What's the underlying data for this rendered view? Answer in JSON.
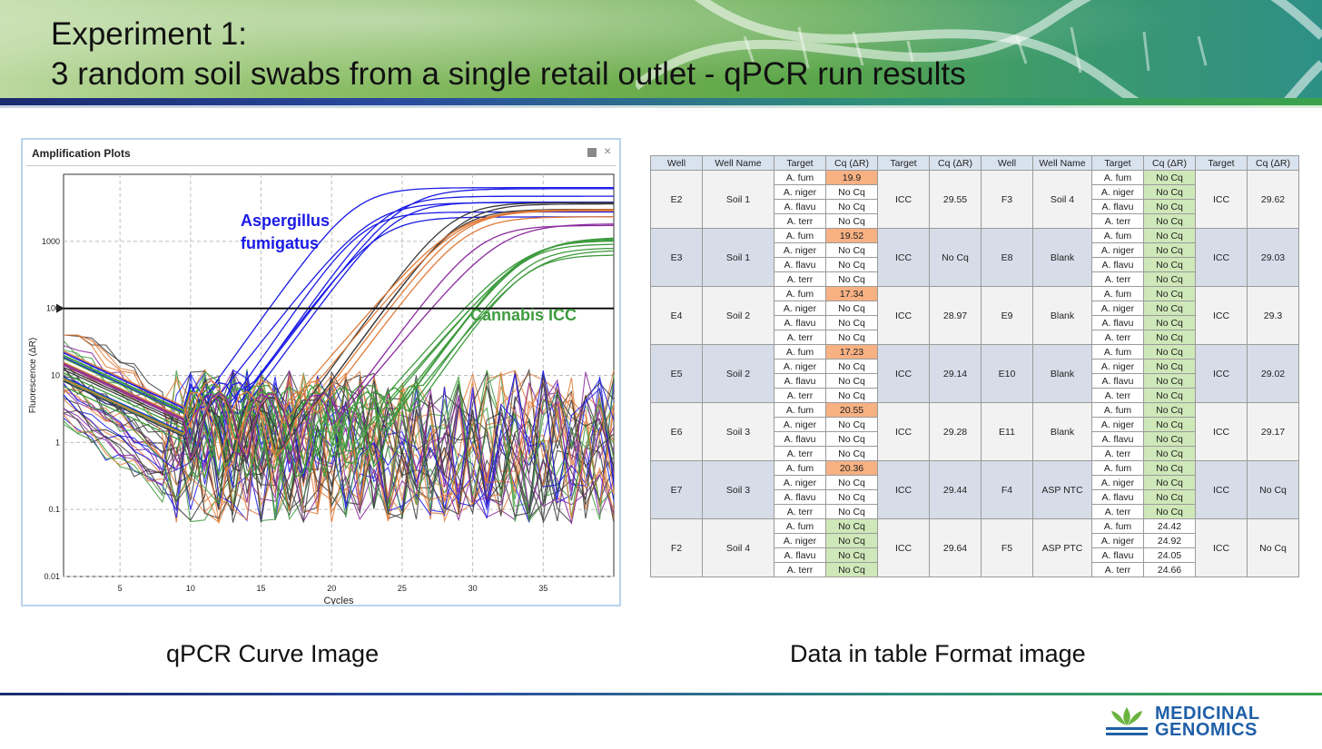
{
  "slide": {
    "title_line1": "Experiment 1:",
    "title_line2": "3 random soil swabs from a single retail outlet - qPCR run results",
    "left_caption": "qPCR Curve Image",
    "right_caption": "Data in table Format image",
    "logo_line1": "MEDICINAL",
    "logo_line2": "GENOMICS"
  },
  "plot_panel": {
    "title": "Amplification Plots",
    "close_icon": "×",
    "annotation_aspergillus_line1": "Aspergillus",
    "annotation_aspergillus_line2": "fumigatus",
    "annotation_cannabis": "Cannabis ICC",
    "colors": {
      "aspergillus": "#1a1ae6",
      "cannabis": "#3f9b3f",
      "threshold": "#000000"
    }
  },
  "chart_data": {
    "type": "line",
    "xlabel": "Cycles",
    "ylabel": "Fluorescence (ΔR)",
    "xlim": [
      1,
      40
    ],
    "ylim": [
      0.01,
      10000
    ],
    "y_scale": "log",
    "x_ticks": [
      5,
      10,
      15,
      20,
      25,
      30,
      35
    ],
    "y_ticks": [
      0.01,
      0.1,
      1,
      10,
      100,
      1000
    ],
    "y_tick_labels": [
      "0.01",
      "0.1",
      "1",
      "10",
      "100",
      "1000"
    ],
    "threshold": 100,
    "grid": true,
    "series_groups": [
      {
        "name": "Aspergillus fumigatus",
        "color": "#1a1ae6",
        "count": 7,
        "cq_range": [
          17.2,
          20.6
        ],
        "plateau": [
          2000,
          6500
        ]
      },
      {
        "name": "Cannabis ICC",
        "color": "#3f9b3f",
        "count": 9,
        "cq_range": [
          28.9,
          29.7
        ],
        "plateau": [
          500,
          1300
        ]
      },
      {
        "color": "#3b3b3b",
        "count": 3,
        "cq_range": [
          24.0,
          24.7
        ],
        "plateau": [
          2500,
          4500
        ]
      },
      {
        "color": "#e07b39",
        "count": 4,
        "cq_range": [
          24.4,
          25.0
        ],
        "plateau": [
          2300,
          3000
        ]
      },
      {
        "color": "#8a2a9e",
        "count": 2,
        "cq_range": [
          26.0,
          27.5
        ],
        "plateau": [
          1700,
          2200
        ]
      }
    ]
  },
  "table": {
    "headers": [
      "Well",
      "Well Name",
      "Target",
      "Cq (ΔR)",
      "Target",
      "Cq (ΔR)",
      "Well",
      "Well Name",
      "Target",
      "Cq (ΔR)",
      "Target",
      "Cq (ΔR)"
    ],
    "groups": [
      {
        "well": "E2",
        "well_name": "Soil 1",
        "icc_target": "ICC",
        "icc_cq": "29.55",
        "well_r": "F3",
        "well_name_r": "Soil 4",
        "icc_target_r": "ICC",
        "icc_cq_r": "29.62",
        "rows": [
          {
            "target": "A. fum",
            "cq": "19.9",
            "target_r": "A. fum",
            "cq_r": "No Cq"
          },
          {
            "target": "A. niger",
            "cq": "No Cq",
            "target_r": "A. niger",
            "cq_r": "No Cq"
          },
          {
            "target": "A. flavu",
            "cq": "No Cq",
            "target_r": "A. flavu",
            "cq_r": "No Cq"
          },
          {
            "target": "A. terr",
            "cq": "No Cq",
            "target_r": "A. terr",
            "cq_r": "No Cq"
          }
        ]
      },
      {
        "well": "E3",
        "well_name": "Soil 1",
        "icc_target": "ICC",
        "icc_cq": "No Cq",
        "well_r": "E8",
        "well_name_r": "Blank",
        "icc_target_r": "ICC",
        "icc_cq_r": "29.03",
        "rows": [
          {
            "target": "A. fum",
            "cq": "19.52",
            "target_r": "A. fum",
            "cq_r": "No Cq"
          },
          {
            "target": "A. niger",
            "cq": "No Cq",
            "target_r": "A. niger",
            "cq_r": "No Cq"
          },
          {
            "target": "A. flavu",
            "cq": "No Cq",
            "target_r": "A. flavu",
            "cq_r": "No Cq"
          },
          {
            "target": "A. terr",
            "cq": "No Cq",
            "target_r": "A. terr",
            "cq_r": "No Cq"
          }
        ]
      },
      {
        "well": "E4",
        "well_name": "Soil 2",
        "icc_target": "ICC",
        "icc_cq": "28.97",
        "well_r": "E9",
        "well_name_r": "Blank",
        "icc_target_r": "ICC",
        "icc_cq_r": "29.3",
        "rows": [
          {
            "target": "A. fum",
            "cq": "17.34",
            "target_r": "A. fum",
            "cq_r": "No Cq"
          },
          {
            "target": "A. niger",
            "cq": "No Cq",
            "target_r": "A. niger",
            "cq_r": "No Cq"
          },
          {
            "target": "A. flavu",
            "cq": "No Cq",
            "target_r": "A. flavu",
            "cq_r": "No Cq"
          },
          {
            "target": "A. terr",
            "cq": "No Cq",
            "target_r": "A. terr",
            "cq_r": "No Cq"
          }
        ]
      },
      {
        "well": "E5",
        "well_name": "Soil 2",
        "icc_target": "ICC",
        "icc_cq": "29.14",
        "well_r": "E10",
        "well_name_r": "Blank",
        "icc_target_r": "ICC",
        "icc_cq_r": "29.02",
        "rows": [
          {
            "target": "A. fum",
            "cq": "17.23",
            "target_r": "A. fum",
            "cq_r": "No Cq"
          },
          {
            "target": "A. niger",
            "cq": "No Cq",
            "target_r": "A. niger",
            "cq_r": "No Cq"
          },
          {
            "target": "A. flavu",
            "cq": "No Cq",
            "target_r": "A. flavu",
            "cq_r": "No Cq"
          },
          {
            "target": "A. terr",
            "cq": "No Cq",
            "target_r": "A. terr",
            "cq_r": "No Cq"
          }
        ]
      },
      {
        "well": "E6",
        "well_name": "Soil 3",
        "icc_target": "ICC",
        "icc_cq": "29.28",
        "well_r": "E11",
        "well_name_r": "Blank",
        "icc_target_r": "ICC",
        "icc_cq_r": "29.17",
        "rows": [
          {
            "target": "A. fum",
            "cq": "20.55",
            "target_r": "A. fum",
            "cq_r": "No Cq"
          },
          {
            "target": "A. niger",
            "cq": "No Cq",
            "target_r": "A. niger",
            "cq_r": "No Cq"
          },
          {
            "target": "A. flavu",
            "cq": "No Cq",
            "target_r": "A. flavu",
            "cq_r": "No Cq"
          },
          {
            "target": "A. terr",
            "cq": "No Cq",
            "target_r": "A. terr",
            "cq_r": "No Cq"
          }
        ]
      },
      {
        "well": "E7",
        "well_name": "Soil 3",
        "icc_target": "ICC",
        "icc_cq": "29.44",
        "well_r": "F4",
        "well_name_r": "ASP NTC",
        "icc_target_r": "ICC",
        "icc_cq_r": "No Cq",
        "rows": [
          {
            "target": "A. fum",
            "cq": "20.36",
            "target_r": "A. fum",
            "cq_r": "No Cq"
          },
          {
            "target": "A. niger",
            "cq": "No Cq",
            "target_r": "A. niger",
            "cq_r": "No Cq"
          },
          {
            "target": "A. flavu",
            "cq": "No Cq",
            "target_r": "A. flavu",
            "cq_r": "No Cq"
          },
          {
            "target": "A. terr",
            "cq": "No Cq",
            "target_r": "A. terr",
            "cq_r": "No Cq"
          }
        ]
      },
      {
        "well": "F2",
        "well_name": "Soil 4",
        "icc_target": "ICC",
        "icc_cq": "29.64",
        "well_r": "F5",
        "well_name_r": "ASP PTC",
        "icc_target_r": "ICC",
        "icc_cq_r": "No Cq",
        "rows": [
          {
            "target": "A. fum",
            "cq": "No Cq",
            "target_r": "A. fum",
            "cq_r": "24.42"
          },
          {
            "target": "A. niger",
            "cq": "No Cq",
            "target_r": "A. niger",
            "cq_r": "24.92"
          },
          {
            "target": "A. flavu",
            "cq": "No Cq",
            "target_r": "A. flavu",
            "cq_r": "24.05"
          },
          {
            "target": "A. terr",
            "cq": "No Cq",
            "target_r": "A. terr",
            "cq_r": "24.66"
          }
        ]
      }
    ],
    "highlight_colors": {
      "positive": "#f7b183",
      "negative_control": "#cfe8b9"
    }
  }
}
